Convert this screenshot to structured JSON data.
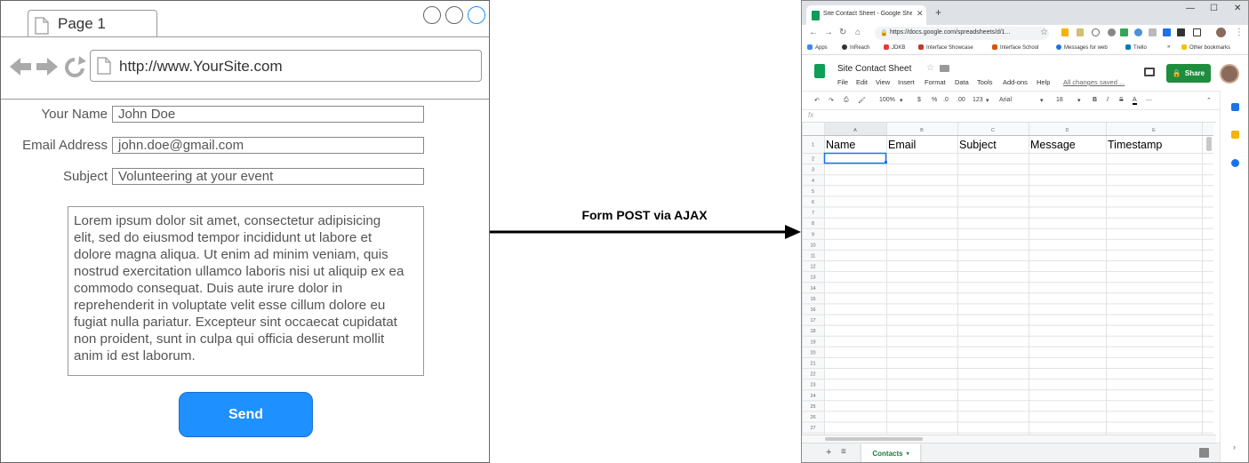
{
  "wireframe": {
    "tab_label": "Page 1",
    "url": "http://www.YourSite.com",
    "form": {
      "name_label": "Your Name",
      "name_value": "John Doe",
      "email_label": "Email Address",
      "email_value": "john.doe@gmail.com",
      "subject_label": "Subject",
      "subject_value": "Volunteering at your event",
      "message_lines": [
        "Lorem ipsum dolor sit amet, consectetur adipisicing",
        "elit, sed do eiusmod tempor incididunt ut labore et",
        "dolore magna aliqua. Ut enim ad minim veniam, quis",
        "nostrud exercitation ullamco laboris nisi ut aliquip ex ea",
        "commodo consequat. Duis aute irure dolor in",
        "reprehenderit in voluptate velit esse cillum dolore eu",
        "fugiat nulla pariatur. Excepteur sint occaecat cupidatat",
        "non proident, sunt in culpa qui officia deserunt mollit",
        "anim id est laborum."
      ],
      "send_label": "Send"
    }
  },
  "arrow": {
    "label": "Form POST via AJAX"
  },
  "sheets": {
    "tab_title": "Site Contact Sheet - Google Shee",
    "url": "https://docs.google.com/spreadsheets/d/1...",
    "bookmarks": [
      "Apps",
      "InReach",
      "JDKB",
      "Interface Showcase",
      "Interface School",
      "Messages for web",
      "Trello",
      "»",
      "Other bookmarks"
    ],
    "doc_title": "Site Contact Sheet",
    "menu": [
      "File",
      "Edit",
      "View",
      "Insert",
      "Format",
      "Data",
      "Tools",
      "Add-ons",
      "Help"
    ],
    "saved_status": "All changes saved ...",
    "share_label": "Share",
    "toolbar": {
      "zoom": "100%",
      "currency": "$",
      "percent": "%",
      "dec_less": ".0",
      "dec_more": ".00",
      "format": "123",
      "font": "Arial",
      "size": "18",
      "bold": "B",
      "italic": "I",
      "strike": "S",
      "textcolor": "A"
    },
    "fx_label": "fx",
    "columns": [
      "A",
      "B",
      "C",
      "D",
      "E"
    ],
    "headers": [
      "Name",
      "Email",
      "Subject",
      "Message",
      "Timestamp"
    ],
    "row_count": 27,
    "sheet_tab": "Contacts",
    "colors": {
      "accent": "#0f9d58",
      "share": "#1e8e3e",
      "selection": "#1a73e8"
    }
  }
}
